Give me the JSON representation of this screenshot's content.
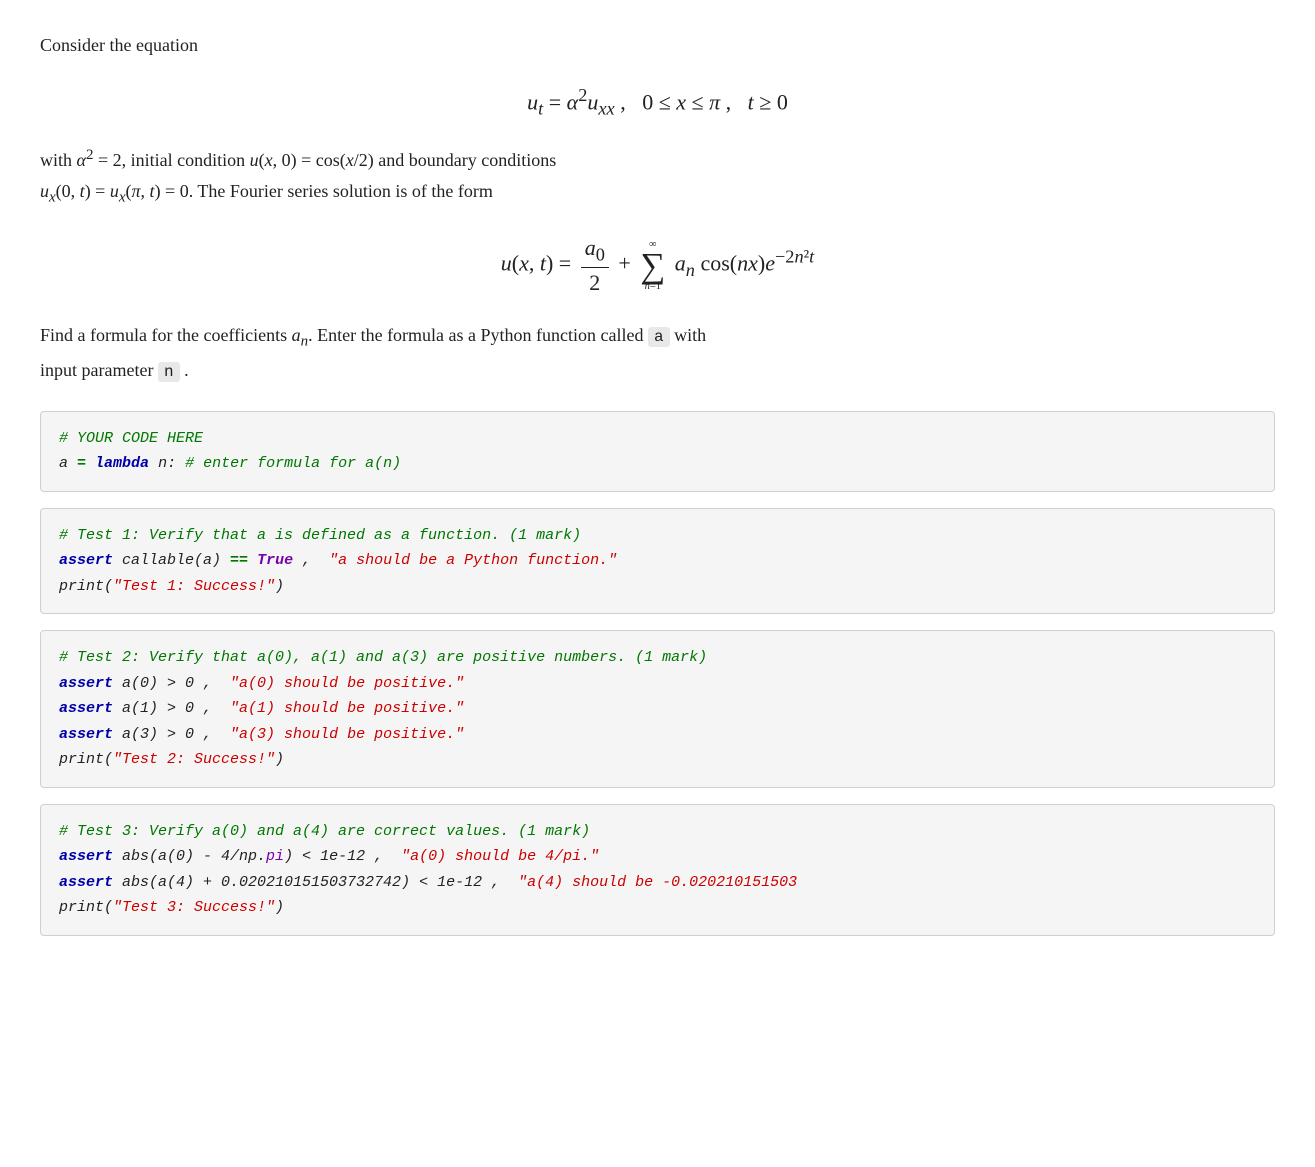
{
  "page": {
    "intro_text": "Consider the equation",
    "eq1_display": "u_t = α²u_xx ,   0 ≤ x ≤ π ,   t ≥ 0",
    "paragraph1": "with α² = 2, initial condition u(x, 0) = cos(x/2) and boundary conditions",
    "paragraph2": "u_x(0, t) = u_x(π, t) = 0. The Fourier series solution is of the form",
    "prompt_text_before": "Find a formula for the coefficients",
    "prompt_an": "aₙ",
    "prompt_text_after": ". Enter the formula as a Python function called",
    "prompt_a_code": "a",
    "prompt_text_end": "with",
    "prompt_input": "input parameter",
    "prompt_n_code": "n",
    "prompt_period": ".",
    "code_block1_line1": "# YOUR CODE HERE",
    "code_block1_line2_before": "a ",
    "code_block1_line2_kw": "=",
    "code_block1_line2_kw2": "lambda",
    "code_block1_line2_after": " n: ",
    "code_block1_line2_comment": "# enter formula for a(n)",
    "test1_comment": "# Test 1: Verify that a is defined as a function. (1 mark)",
    "test1_assert_kw": "assert",
    "test1_assert_body": " callable(a) ",
    "test1_eq_kw": "==",
    "test1_true_kw": " True",
    "test1_comma": " ,  ",
    "test1_str": "\"a should be a Python function.\"",
    "test1_print": "print(\"Test 1: Success!\")",
    "test2_comment": "# Test 2: Verify that a(0), a(1) and a(3) are positive numbers. (1 mark)",
    "test2_assert1_kw": "assert",
    "test2_assert1_body": " a(0) > 0 , ",
    "test2_assert1_str": "\"a(0) should be positive.\"",
    "test2_assert2_kw": "assert",
    "test2_assert2_body": " a(1) > 0 , ",
    "test2_assert2_str": "\"a(1) should be positive.\"",
    "test2_assert3_kw": "assert",
    "test2_assert3_body": " a(3) > 0 , ",
    "test2_assert3_str": "\"a(3) should be positive.\"",
    "test2_print": "print(\"Test 2: Success!\")",
    "test3_comment": "# Test 3: Verify a(0) and a(4) are correct values. (1 mark)",
    "test3_assert1_kw": "assert",
    "test3_assert1_body": " abs(a(0) - 4/np.",
    "test3_assert1_attr": "pi",
    "test3_assert1_body2": ") < 1e-12 , ",
    "test3_assert1_str": "\"a(0) should be 4/pi.\"",
    "test3_assert2_kw": "assert",
    "test3_assert2_body": " abs(a(4) + 0.020210151503732742) < 1e-12 ,  ",
    "test3_assert2_str": "\"a(4) should be -0.020210151503",
    "test3_print": "print(\"Test 3: Success!\")"
  }
}
